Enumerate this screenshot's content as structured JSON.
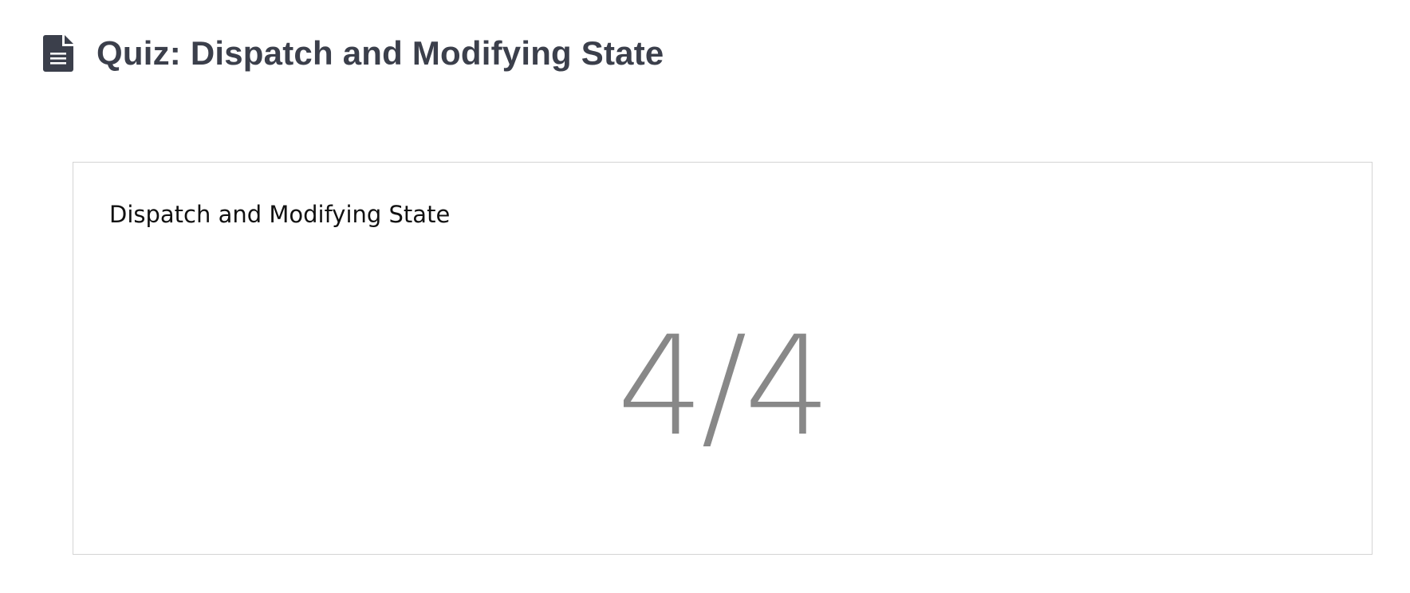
{
  "header": {
    "title": "Quiz: Dispatch and Modifying State",
    "icon": "document-icon"
  },
  "quiz_card": {
    "title": "Dispatch and Modifying State",
    "score": "4/4"
  },
  "colors": {
    "title_text": "#3b3f4b",
    "icon": "#3b3f4b",
    "score_text": "#888888",
    "card_border": "#d4d4d4"
  }
}
